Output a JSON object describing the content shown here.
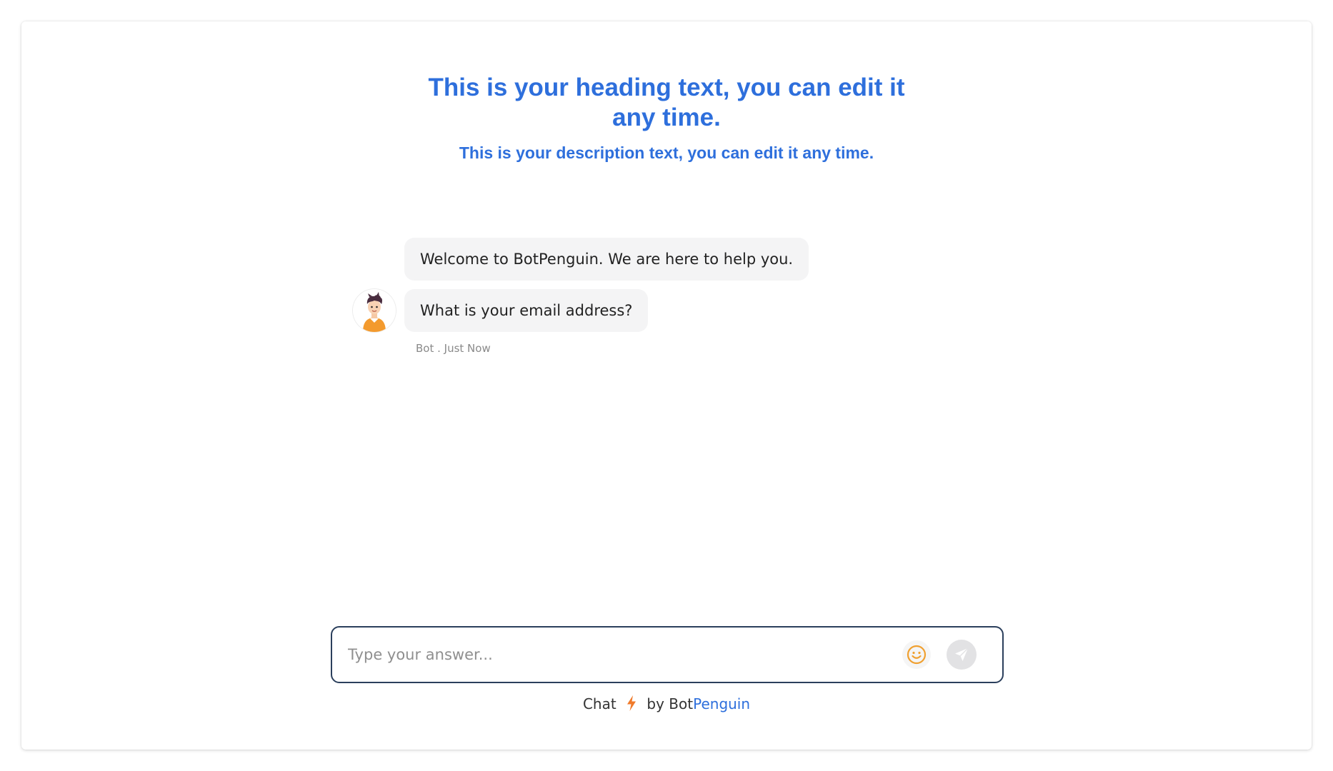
{
  "header": {
    "heading": "This is your heading text, you can edit it any time.",
    "description": "This is your description text, you can edit it any time."
  },
  "messages": [
    {
      "sender": "bot",
      "text": "Welcome to BotPenguin. We are here to help you."
    },
    {
      "sender": "bot",
      "text": "What is your email address?"
    }
  ],
  "message_meta": "Bot . Just Now",
  "input": {
    "placeholder": "Type your answer...",
    "value": ""
  },
  "icons": {
    "emoji": "smiley-face-icon",
    "send": "paper-plane-icon",
    "avatar": "bot-avatar-icon",
    "bolt": "lightning-bolt-icon"
  },
  "footer": {
    "prefix": "Chat",
    "by_text": "by Bot",
    "brand_highlight": "Penguin"
  },
  "colors": {
    "heading": "#2e6fdc",
    "input_border": "#2b3f5c",
    "emoji": "#f0a030",
    "bolt": "#f07a2a",
    "send_bg": "#e2e2e4",
    "bubble_bg": "#f4f4f5"
  }
}
